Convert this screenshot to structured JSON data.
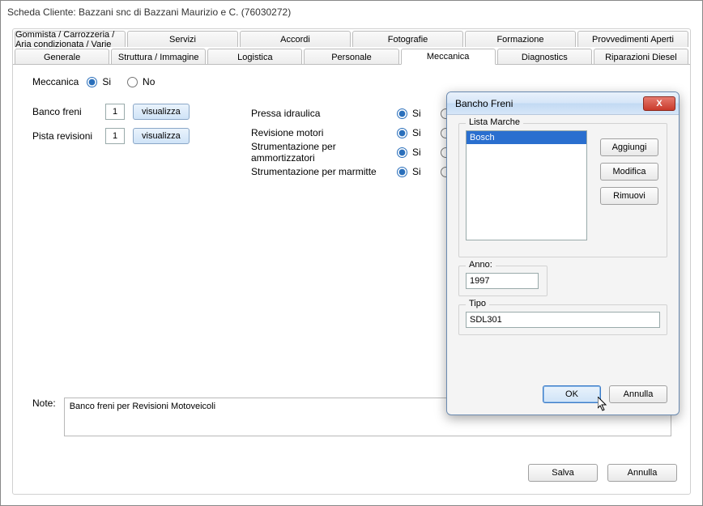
{
  "title": "Scheda Cliente: Bazzani snc di Bazzani Maurizio e C. (76030272)",
  "tabs_row1": [
    "Gommista / Carrozzeria / Aria condizionata / Varie",
    "Servizi",
    "Accordi",
    "Fotografie",
    "Formazione",
    "Provvedimenti Aperti"
  ],
  "tabs_row2": [
    "Generale",
    "Struttura / Immagine",
    "Logistica",
    "Personale",
    "Meccanica",
    "Diagnostics",
    "Riparazioni Diesel"
  ],
  "active_tab": "Meccanica",
  "meccanica": {
    "label": "Meccanica",
    "si": "Si",
    "no": "No",
    "selected": "Si",
    "banco_freni_label": "Banco freni",
    "banco_freni_value": "1",
    "pista_revisioni_label": "Pista revisioni",
    "pista_revisioni_value": "1",
    "visualizza": "visualizza",
    "options": [
      {
        "label": "Pressa idraulica",
        "value": "Si"
      },
      {
        "label": "Revisione motori",
        "value": "Si"
      },
      {
        "label": "Strumentazione per ammortizzatori",
        "value": "Si"
      },
      {
        "label": "Strumentazione per marmitte",
        "value": "Si"
      }
    ]
  },
  "note_label": "Note:",
  "note_value": "Banco freni per Revisioni Motoveicoli",
  "btn_salva": "Salva",
  "btn_annulla": "Annulla",
  "dialog": {
    "title": "Bancho Freni",
    "lista_marche_label": "Lista Marche",
    "lista_marche_items": [
      "Bosch"
    ],
    "btn_aggiungi": "Aggiungi",
    "btn_modifica": "Modifica",
    "btn_rimuovi": "Rimuovi",
    "anno_label": "Anno:",
    "anno_value": "1997",
    "tipo_label": "Tipo",
    "tipo_value": "SDL301",
    "btn_ok": "OK",
    "btn_annulla": "Annulla"
  }
}
